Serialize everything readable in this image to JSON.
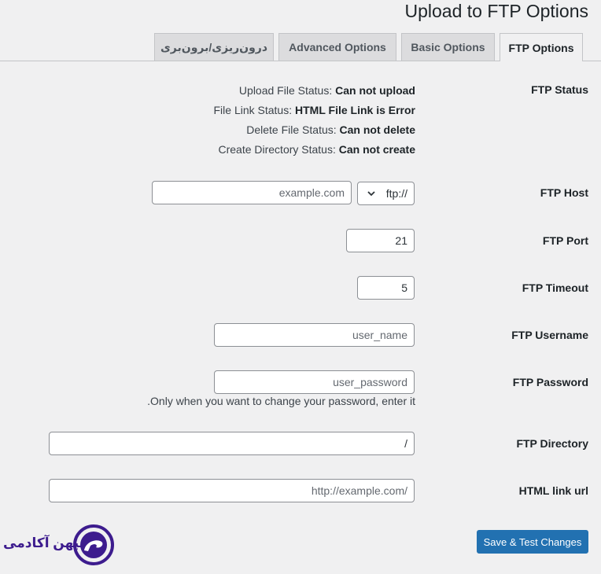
{
  "header": {
    "title": "Upload to FTP Options"
  },
  "tabs": [
    {
      "label": "FTP Options",
      "active": true
    },
    {
      "label": "Basic Options",
      "active": false
    },
    {
      "label": "Advanced Options",
      "active": false
    },
    {
      "label": "درون‌ریزی/برون‌بری",
      "active": false
    }
  ],
  "status": {
    "label": "FTP Status",
    "lines": [
      {
        "key": "Upload File Status:",
        "value": "Can not upload"
      },
      {
        "key": "File Link Status:",
        "value": "HTML File Link is Error"
      },
      {
        "key": "Delete File Status:",
        "value": "Can not delete"
      },
      {
        "key": "Create Directory Status:",
        "value": "Can not create"
      }
    ]
  },
  "fields": {
    "host": {
      "label": "FTP Host",
      "protocol": "ftp://",
      "placeholder": "example.com"
    },
    "port": {
      "label": "FTP Port",
      "value": "21"
    },
    "timeout": {
      "label": "FTP Timeout",
      "value": "5"
    },
    "username": {
      "label": "FTP Username",
      "placeholder": "user_name"
    },
    "password": {
      "label": "FTP Password",
      "placeholder": "user_password",
      "help": ".Only when you want to change your password, enter it"
    },
    "directory": {
      "label": "FTP Directory",
      "value": "/"
    },
    "html_link": {
      "label": "HTML link url",
      "placeholder": "http://example.com/"
    }
  },
  "actions": {
    "save_label": "Save & Test Changes"
  },
  "brand": {
    "name": "میهن آکادمی",
    "color": "#3d1c8e",
    "accent": "#2271b1"
  }
}
